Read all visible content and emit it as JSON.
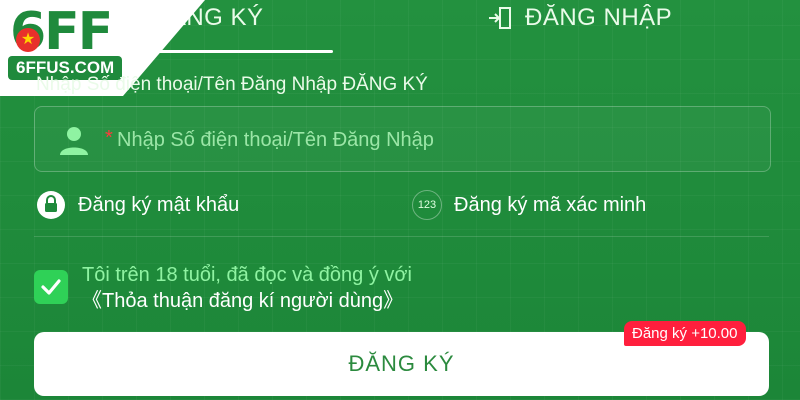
{
  "brand": {
    "logo_text": "6FF",
    "logo_sub": "6FFUS.COM",
    "logo_star": "★"
  },
  "tabs": {
    "register": "ĐĂNG KÝ",
    "login": "ĐĂNG NHẬP",
    "active": "register"
  },
  "form": {
    "section_label": "Nhập Số điện thoại/Tên Đăng Nhập ĐĂNG KÝ",
    "username": {
      "placeholder": "Nhập Số điện thoại/Tên Đăng Nhập",
      "required_mark": "*",
      "value": ""
    },
    "options": {
      "password_label": "Đăng ký mật khẩu",
      "code_badge": "123",
      "code_label": "Đăng ký mã xác minh"
    },
    "agreement": {
      "checked": true,
      "text": "Tôi trên 18 tuổi, đã đọc và đồng ý với ",
      "link": "《Thỏa thuận đăng kí người dùng》"
    },
    "submit_label": "ĐĂNG KÝ",
    "bonus_badge": "Đăng ký +10.00"
  },
  "colors": {
    "background": "#1f8a3c",
    "accent_light": "#8ff3a2",
    "checkbox": "#2fd157",
    "required": "#ff3b3b",
    "bonus": "#ff1f3d",
    "button_text": "#2b8a3e"
  },
  "icons": {
    "logo_star": "star-icon",
    "login": "login-door-icon",
    "user": "user-icon",
    "lock": "lock-icon",
    "check": "checkmark-icon"
  }
}
